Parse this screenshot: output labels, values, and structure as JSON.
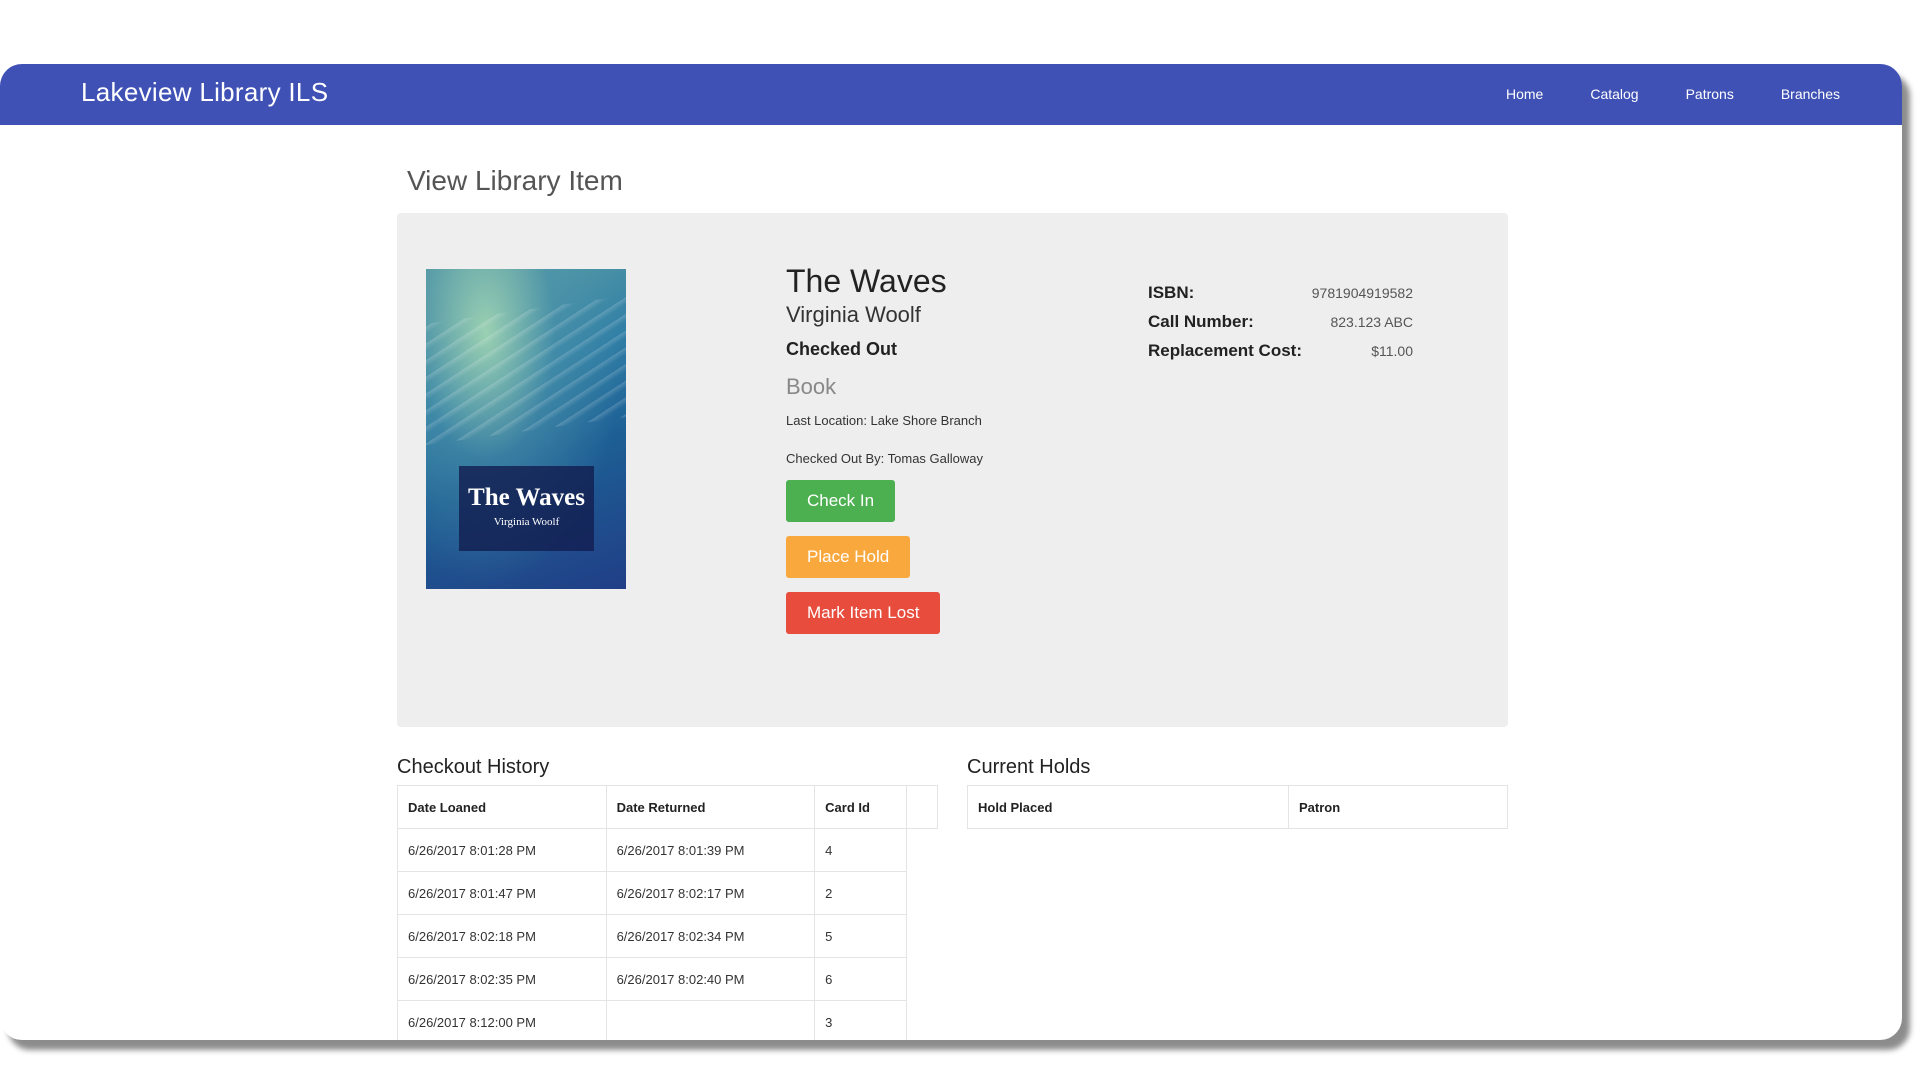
{
  "navbar": {
    "brand": "Lakeview Library ILS",
    "links": [
      "Home",
      "Catalog",
      "Patrons",
      "Branches"
    ]
  },
  "page": {
    "title": "View Library Item"
  },
  "item": {
    "cover_title": "The Waves",
    "cover_author": "Virginia Woolf",
    "title": "The Waves",
    "author": "Virginia Woolf",
    "status": "Checked Out",
    "type": "Book",
    "last_location": "Last Location: Lake Shore Branch",
    "checked_out_by": "Checked Out By: Tomas Galloway",
    "isbn_label": "ISBN:",
    "isbn": "9781904919582",
    "call_number_label": "Call Number:",
    "call_number": "823.123 ABC",
    "replacement_cost_label": "Replacement Cost:",
    "replacement_cost": "$11.00"
  },
  "actions": {
    "check_in": "Check In",
    "place_hold": "Place Hold",
    "mark_lost": "Mark Item Lost"
  },
  "checkout_history": {
    "title": "Checkout History",
    "headers": [
      "Date Loaned",
      "Date Returned",
      "Card Id"
    ],
    "rows": [
      [
        "6/26/2017 8:01:28 PM",
        "6/26/2017 8:01:39 PM",
        "4"
      ],
      [
        "6/26/2017 8:01:47 PM",
        "6/26/2017 8:02:17 PM",
        "2"
      ],
      [
        "6/26/2017 8:02:18 PM",
        "6/26/2017 8:02:34 PM",
        "5"
      ],
      [
        "6/26/2017 8:02:35 PM",
        "6/26/2017 8:02:40 PM",
        "6"
      ],
      [
        "6/26/2017 8:12:00 PM",
        "",
        "3"
      ]
    ]
  },
  "current_holds": {
    "title": "Current Holds",
    "headers": [
      "Hold Placed",
      "Patron"
    ]
  },
  "colors": {
    "navbar": "#3f51b5",
    "check_in": "#4caf50",
    "place_hold": "#f9a83e",
    "mark_lost": "#e74c3c"
  }
}
